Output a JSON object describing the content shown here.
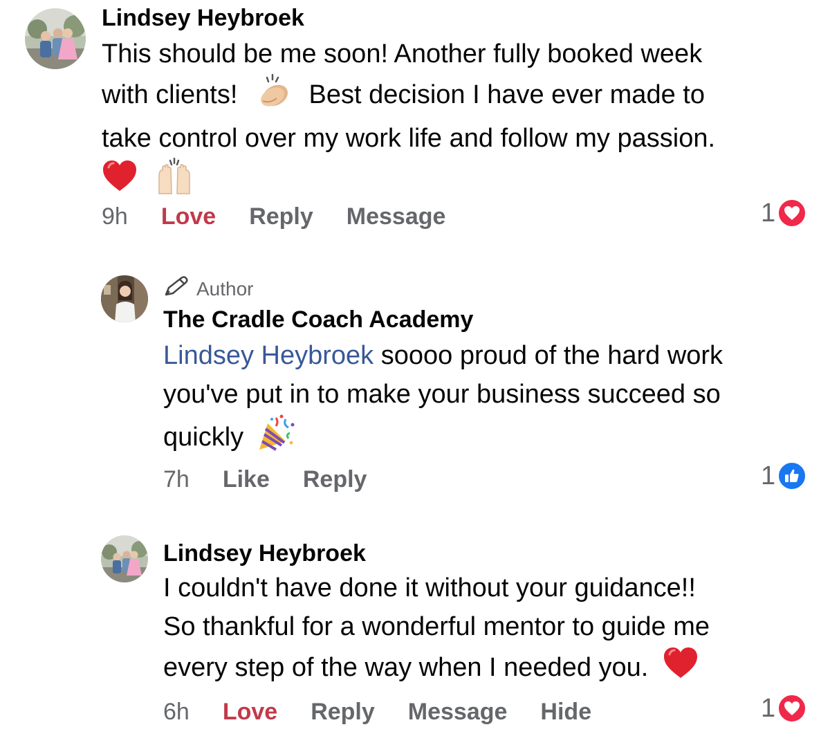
{
  "comments": [
    {
      "author": "Lindsey Heybroek",
      "lines": [
        "This should be me soon! Another fully booked week",
        "with clients!",
        "Best decision I have ever made to",
        "take control over my work life and follow my passion."
      ],
      "emojis": [
        "clapping-hands",
        "red-heart",
        "raising-hands"
      ],
      "time": "9h",
      "actions": [
        "Love",
        "Reply",
        "Message"
      ],
      "reaction_count": "1",
      "reaction_type": "love"
    },
    {
      "badge": "Author",
      "author": "The Cradle Coach Academy",
      "mention": "Lindsey Heybroek",
      "lines": [
        " soooo proud of the hard work",
        "you've put in to make your business succeed so",
        "quickly"
      ],
      "emojis": [
        "party-popper"
      ],
      "time": "7h",
      "actions": [
        "Like",
        "Reply"
      ],
      "reaction_count": "1",
      "reaction_type": "like"
    },
    {
      "author": "Lindsey Heybroek",
      "lines": [
        "I couldn't have done it without your guidance!!",
        "So thankful for a wonderful mentor to guide me",
        "every step of the way when I needed you."
      ],
      "emojis": [
        "red-heart"
      ],
      "time": "6h",
      "actions": [
        "Love",
        "Reply",
        "Message",
        "Hide"
      ],
      "reaction_count": "1",
      "reaction_type": "love"
    }
  ],
  "colors": {
    "love": "#f0284a",
    "like": "#1877f2",
    "loved_text": "#c13a4a",
    "secondary": "#65676b",
    "mention": "#385898"
  }
}
